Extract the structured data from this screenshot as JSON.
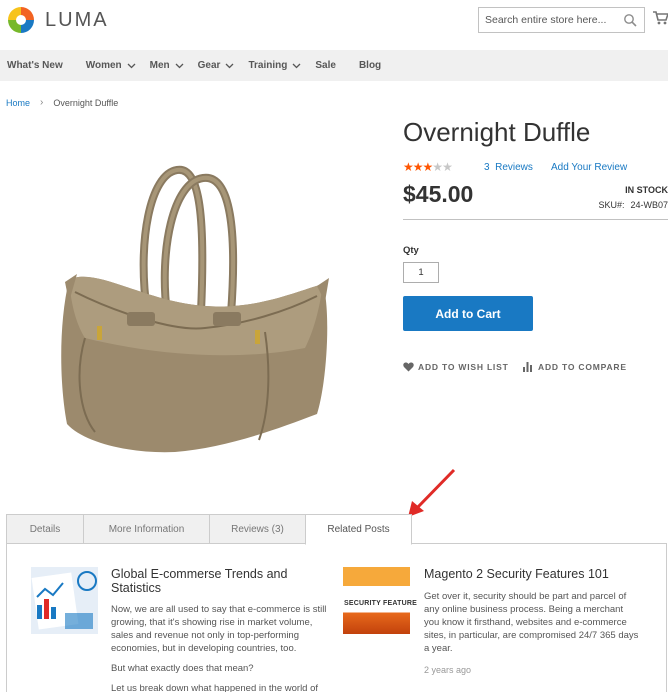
{
  "header": {
    "logo_text": "LUMA",
    "search_placeholder": "Search entire store here..."
  },
  "nav": {
    "items": [
      {
        "label": "What's New",
        "dropdown": false
      },
      {
        "label": "Women",
        "dropdown": true
      },
      {
        "label": "Men",
        "dropdown": true
      },
      {
        "label": "Gear",
        "dropdown": true
      },
      {
        "label": "Training",
        "dropdown": true
      },
      {
        "label": "Sale",
        "dropdown": false
      },
      {
        "label": "Blog",
        "dropdown": false
      }
    ]
  },
  "breadcrumb": {
    "home": "Home",
    "separator": "›",
    "current": "Overnight Duffle"
  },
  "product": {
    "title": "Overnight Duffle",
    "rating_stars": 3,
    "rating_max": 5,
    "reviews_link": "3  Reviews",
    "add_review": "Add Your Review",
    "price": "$45.00",
    "stock": "IN STOCK",
    "sku_label": "SKU#:",
    "sku_value": "24-WB07",
    "qty_label": "Qty",
    "qty_value": "1",
    "add_to_cart": "Add to Cart",
    "wishlist": "ADD TO WISH LIST",
    "compare": "ADD TO COMPARE"
  },
  "tabs": {
    "items": [
      "Details",
      "More Information",
      "Reviews (3)",
      "Related Posts"
    ],
    "active": 3
  },
  "posts": [
    {
      "title": "Global E-commerse Trends and Statistics",
      "text1": "Now, we are all used to say that e-commerce is still growing, that it's showing rise in market volume, sales and revenue not only in top-performing economies, but in developing countries, too.",
      "text2": "But what exactly does that mean?",
      "text3": "Let us break down what happened in the world of"
    },
    {
      "title": "Magento 2 Security Features 101",
      "text1": "Get over it, security should be part and parcel of any online business process. Being a merchant you know it firsthand, websites and e-commerce sites, in particular, are compromised 24/7 365 days a year.",
      "date": "2 years ago",
      "thumb_text": "SECURITY FEATURE"
    }
  ],
  "colors": {
    "accent": "#1979c3",
    "star_on": "#ff5501",
    "star_off": "#c7c7c7",
    "nav_bg": "#f0f0f0",
    "annotation": "#e02b27"
  }
}
